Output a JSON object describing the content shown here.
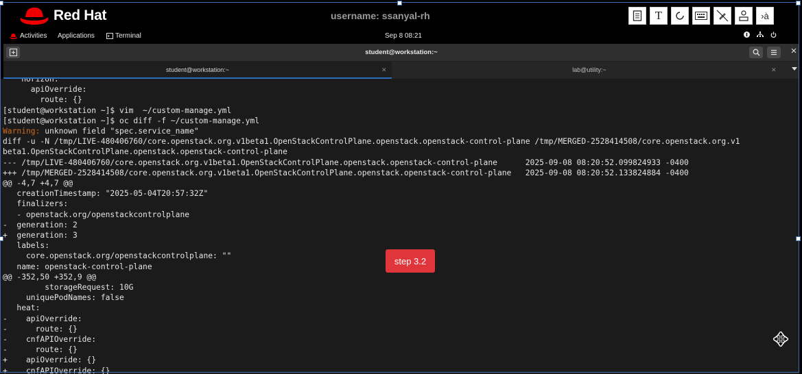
{
  "top_bar": {
    "brand": "Red Hat",
    "username": "username: ssanyal-rh",
    "tools": [
      {
        "icon": "notes-icon",
        "text": ""
      },
      {
        "icon": "text-tool-icon",
        "text": "T"
      },
      {
        "icon": "refresh-icon",
        "text": ""
      },
      {
        "icon": "keyboard-icon",
        "text": ""
      },
      {
        "icon": "slashed-pen-icon",
        "text": ""
      },
      {
        "icon": "upload-person-icon",
        "text": ""
      },
      {
        "icon": "accent-input-icon",
        "text": "›à"
      }
    ]
  },
  "gnome_panel": {
    "activities": "Activities",
    "applications": "Applications",
    "terminal": "Terminal",
    "clock": "Sep 8  08:21"
  },
  "window": {
    "title": "student@workstation:~"
  },
  "tabs": [
    {
      "label": "student@workstation:~",
      "active": true
    },
    {
      "label": "lab@utility:~",
      "active": false
    }
  ],
  "terminal_lines": [
    {
      "text": "    horizon:",
      "warn": ""
    },
    {
      "text": "      apiOverride:",
      "warn": ""
    },
    {
      "text": "        route: {}",
      "warn": ""
    },
    {
      "text": "[student@workstation ~]$ vim  ~/custom-manage.yml",
      "warn": ""
    },
    {
      "text": "[student@workstation ~]$ oc diff -f ~/custom-manage.yml",
      "warn": ""
    },
    {
      "text": " unknown field \"spec.service_name\"",
      "warn": "Warning:"
    },
    {
      "text": "diff -u -N /tmp/LIVE-480406760/core.openstack.org.v1beta1.OpenStackControlPlane.openstack.openstack-control-plane /tmp/MERGED-2528414508/core.openstack.org.v1",
      "warn": ""
    },
    {
      "text": "beta1.OpenStackControlPlane.openstack.openstack-control-plane",
      "warn": ""
    },
    {
      "text": "--- /tmp/LIVE-480406760/core.openstack.org.v1beta1.OpenStackControlPlane.openstack.openstack-control-plane      2025-09-08 08:20:52.099824933 -0400",
      "warn": ""
    },
    {
      "text": "+++ /tmp/MERGED-2528414508/core.openstack.org.v1beta1.OpenStackControlPlane.openstack.openstack-control-plane   2025-09-08 08:20:52.133824884 -0400",
      "warn": ""
    },
    {
      "text": "@@ -4,7 +4,7 @@",
      "warn": ""
    },
    {
      "text": "   creationTimestamp: \"2025-05-04T20:57:32Z\"",
      "warn": ""
    },
    {
      "text": "   finalizers:",
      "warn": ""
    },
    {
      "text": "   - openstack.org/openstackcontrolplane",
      "warn": ""
    },
    {
      "text": "-  generation: 2",
      "warn": ""
    },
    {
      "text": "+  generation: 3",
      "warn": ""
    },
    {
      "text": "   labels:",
      "warn": ""
    },
    {
      "text": "     core.openstack.org/openstackcontrolplane: \"\"",
      "warn": ""
    },
    {
      "text": "   name: openstack-control-plane",
      "warn": ""
    },
    {
      "text": "@@ -352,50 +352,9 @@",
      "warn": ""
    },
    {
      "text": "         storageRequest: 10G",
      "warn": ""
    },
    {
      "text": "     uniquePodNames: false",
      "warn": ""
    },
    {
      "text": "   heat:",
      "warn": ""
    },
    {
      "text": "-    apiOverride:",
      "warn": ""
    },
    {
      "text": "-      route: {}",
      "warn": ""
    },
    {
      "text": "-    cnfAPIOverride:",
      "warn": ""
    },
    {
      "text": "-      route: {}",
      "warn": ""
    },
    {
      "text": "+    apiOverride: {}",
      "warn": ""
    },
    {
      "text": "+    cnfAPIOverride: {}",
      "warn": ""
    }
  ],
  "step_badge": "step 3.2",
  "colors": {
    "terminal_bg": "#1b1b1b",
    "warning": "#cf6a1a",
    "badge": "#e0353b",
    "tab_accent": "#2c6fbd"
  }
}
